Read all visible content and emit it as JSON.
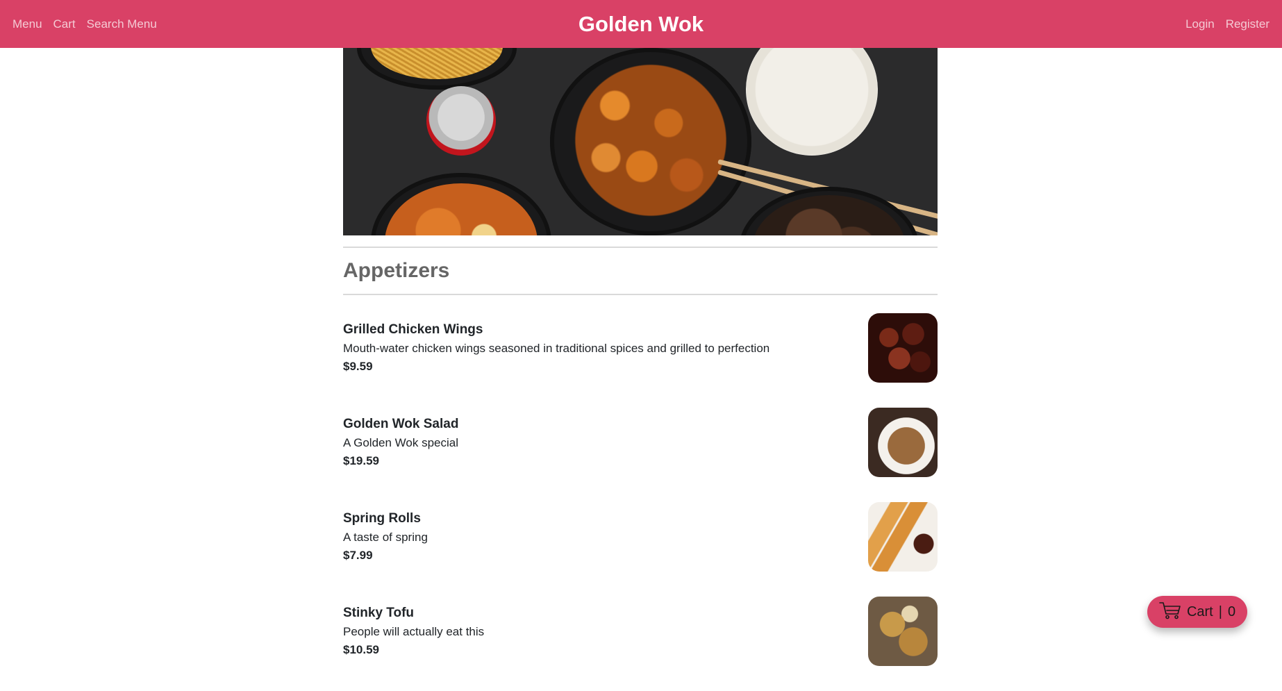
{
  "navbar": {
    "brand": "Golden Wok",
    "left_links": [
      "Menu",
      "Cart",
      "Search Menu"
    ],
    "right_links": [
      "Login",
      "Register"
    ],
    "color": "#d94166"
  },
  "section": {
    "title": "Appetizers"
  },
  "items": [
    {
      "name": "Grilled Chicken Wings",
      "description": "Mouth-water chicken wings seasoned in traditional spices and grilled to perfection",
      "price": "$9.59"
    },
    {
      "name": "Golden Wok Salad",
      "description": "A Golden Wok special",
      "price": "$19.59"
    },
    {
      "name": "Spring Rolls",
      "description": "A taste of spring",
      "price": "$7.99"
    },
    {
      "name": "Stinky Tofu",
      "description": "People will actually eat this",
      "price": "$10.59"
    }
  ],
  "cart_button": {
    "label": "Cart",
    "separator": "|",
    "count": "0",
    "icon": "cart-icon"
  }
}
